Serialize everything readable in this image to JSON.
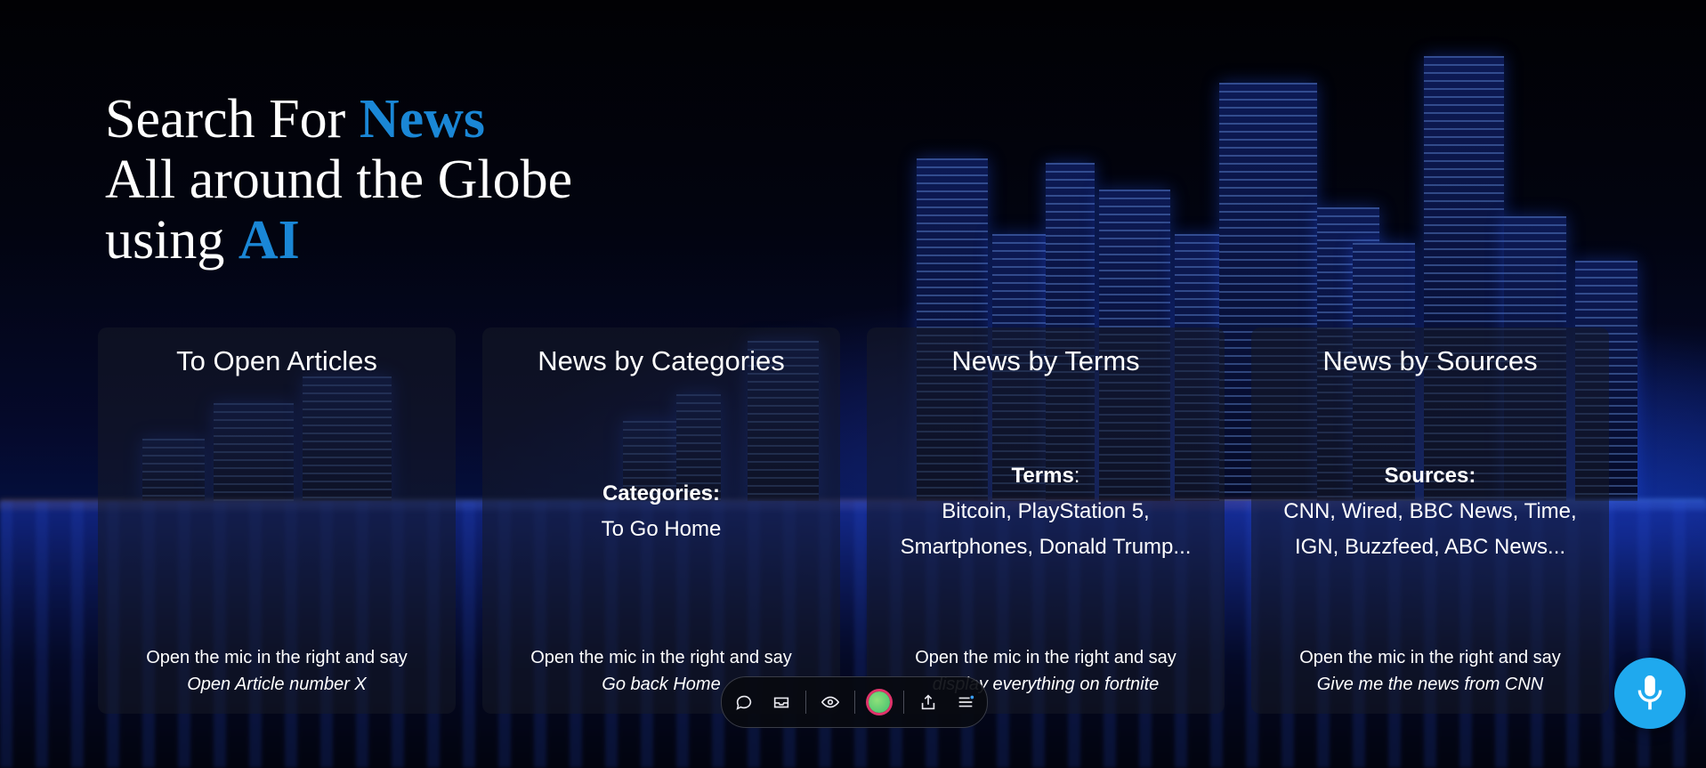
{
  "headline": {
    "line1_prefix": "Search For ",
    "line1_accent": "News",
    "line2": "All around the Globe",
    "line3_prefix": "using ",
    "line3_accent": "AI"
  },
  "cards": [
    {
      "title": "To Open Articles",
      "body_heading": "",
      "body_lines": [],
      "footer_text": "Open the mic in the right and say",
      "footer_command": "Open Article number X"
    },
    {
      "title": "News by Categories",
      "body_heading": "Categories:",
      "body_lines": [
        "To Go Home"
      ],
      "footer_text": "Open the mic in the right and say",
      "footer_command": "Go back Home"
    },
    {
      "title": "News by Terms",
      "body_heading": "Terms",
      "body_heading_suffix": ":",
      "body_lines": [
        "Bitcoin, PlayStation 5,",
        "Smartphones, Donald Trump..."
      ],
      "footer_text": "Open the mic in the right and say",
      "footer_command": "display everything on fortnite"
    },
    {
      "title": "News by Sources",
      "body_heading": "Sources:",
      "body_lines": [
        "CNN, Wired, BBC News, Time,",
        "IGN, Buzzfeed, ABC News..."
      ],
      "footer_text": "Open the mic in the right and say",
      "footer_command": "Give me the news from CNN"
    }
  ],
  "toolbar": {
    "icons": [
      "chat-icon",
      "inbox-icon",
      "eye-icon",
      "color-dot",
      "share-icon",
      "menu-icon"
    ]
  },
  "mic": {
    "icon": "microphone-icon",
    "color": "#1fa9ee"
  },
  "accent_color": "#1a87d6"
}
